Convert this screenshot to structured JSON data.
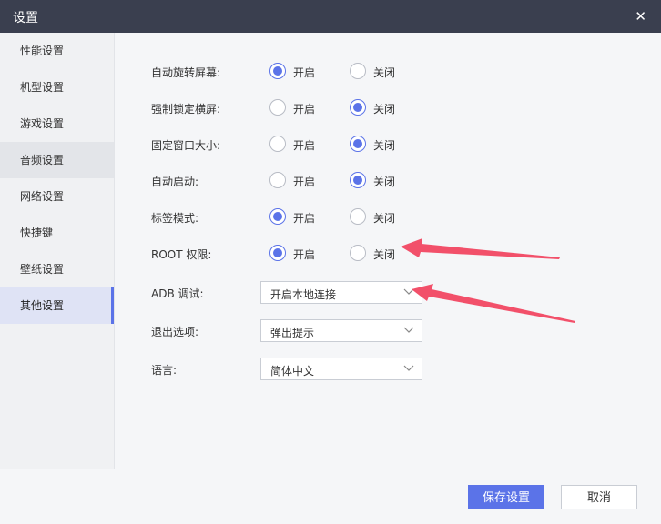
{
  "window": {
    "title": "设置"
  },
  "sidebar": {
    "items": [
      {
        "label": "性能设置"
      },
      {
        "label": "机型设置"
      },
      {
        "label": "游戏设置"
      },
      {
        "label": "音频设置"
      },
      {
        "label": "网络设置"
      },
      {
        "label": "快捷键"
      },
      {
        "label": "壁纸设置"
      },
      {
        "label": "其他设置"
      }
    ],
    "active_label": "其他设置"
  },
  "settings": {
    "rows": [
      {
        "label": "自动旋转屏幕:",
        "on": "开启",
        "off": "关闭",
        "selected": "开启"
      },
      {
        "label": "强制锁定横屏:",
        "on": "开启",
        "off": "关闭",
        "selected": "关闭"
      },
      {
        "label": "固定窗口大小:",
        "on": "开启",
        "off": "关闭",
        "selected": "关闭"
      },
      {
        "label": "自动启动:",
        "on": "开启",
        "off": "关闭",
        "selected": "关闭"
      },
      {
        "label": "标签模式:",
        "on": "开启",
        "off": "关闭",
        "selected": "开启"
      },
      {
        "label": "ROOT 权限:",
        "on": "开启",
        "off": "关闭",
        "selected": "开启"
      }
    ],
    "selects": [
      {
        "label": "ADB 调试:",
        "value": "开启本地连接"
      },
      {
        "label": "退出选项:",
        "value": "弹出提示"
      },
      {
        "label": "语言:",
        "value": "简体中文"
      }
    ]
  },
  "footer": {
    "save_label": "保存设置",
    "cancel_label": "取消"
  },
  "colors": {
    "accent": "#5b73e8",
    "titlebar": "#3a3f4f",
    "annotation_arrow": "#f2506a"
  },
  "icons": {
    "close": "close-icon",
    "dropdown": "chevron-down-icon"
  }
}
